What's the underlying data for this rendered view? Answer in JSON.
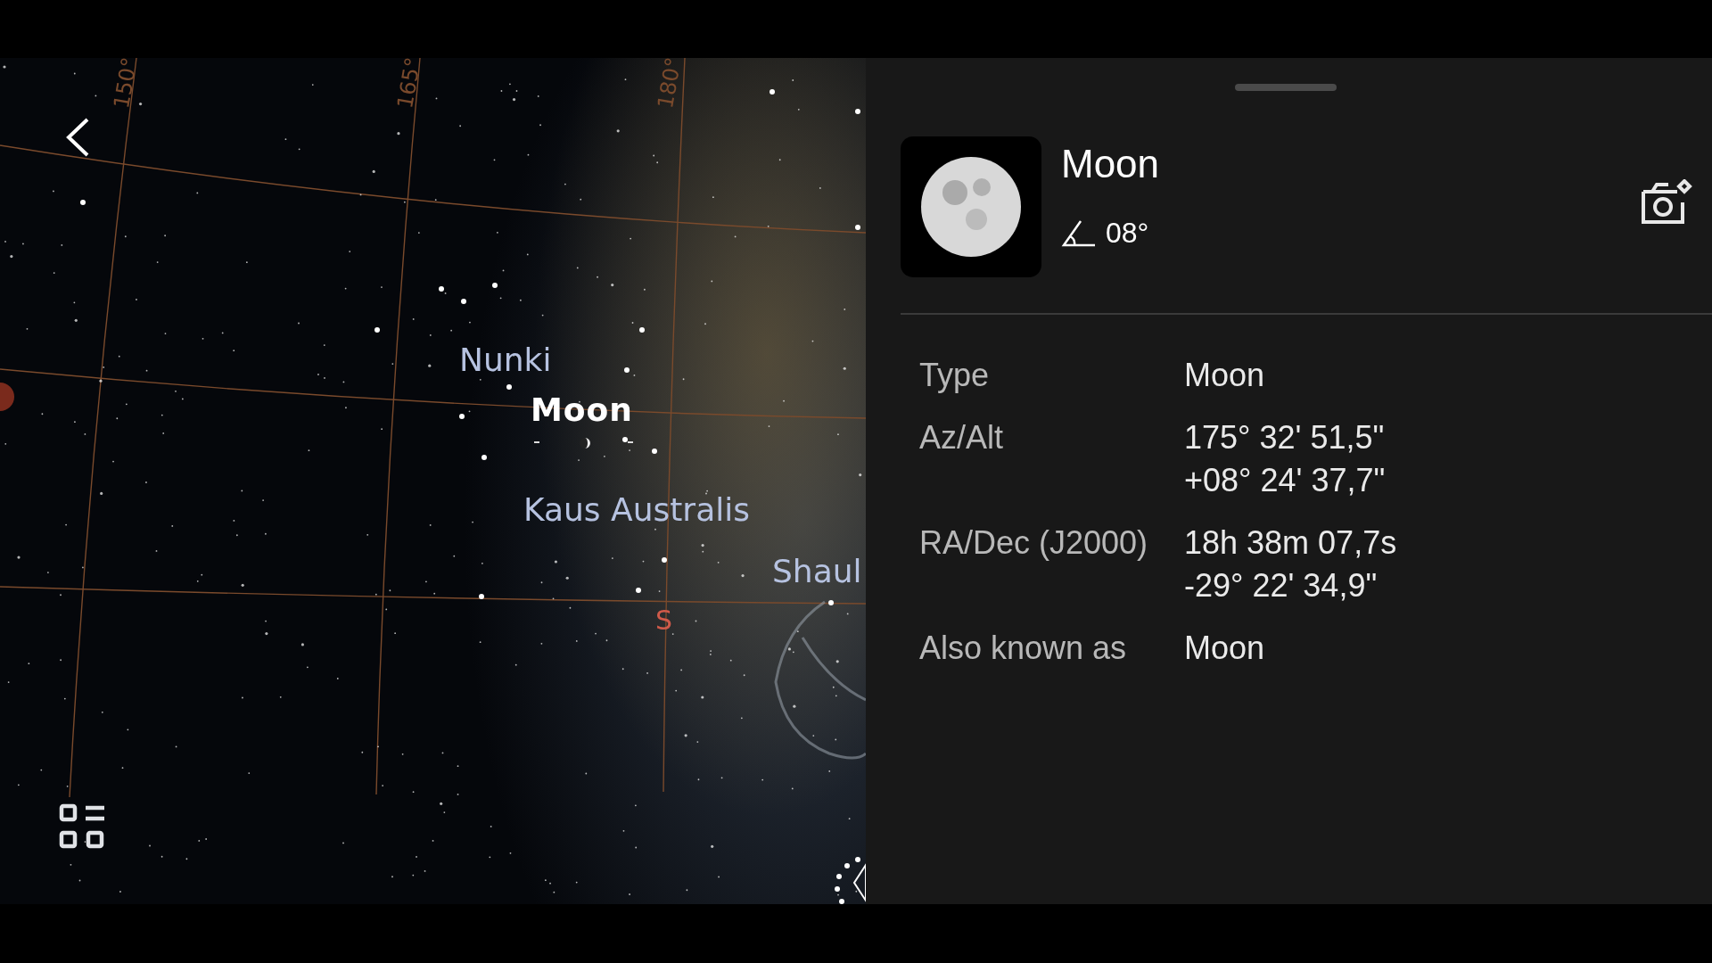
{
  "sky_map": {
    "grid_labels": [
      "150°",
      "165°",
      "180°"
    ],
    "object_labels": [
      {
        "text": "Nunki",
        "selected": false
      },
      {
        "text": "Moon",
        "selected": true
      },
      {
        "text": "Kaus Australis",
        "selected": false
      },
      {
        "text": "Shaul",
        "selected": false
      }
    ],
    "direction_label": "S"
  },
  "detail_panel": {
    "title": "Moon",
    "altitude": "08°",
    "properties": [
      {
        "label": "Type",
        "values": [
          "Moon"
        ]
      },
      {
        "label": "Az/Alt",
        "values": [
          "175° 32' 51,5\"",
          "+08° 24' 37,7\""
        ]
      },
      {
        "label": "RA/Dec (J2000)",
        "values": [
          "18h 38m 07,7s",
          "-29° 22' 34,9\""
        ]
      },
      {
        "label": "Also known as",
        "values": [
          "Moon"
        ]
      }
    ]
  }
}
